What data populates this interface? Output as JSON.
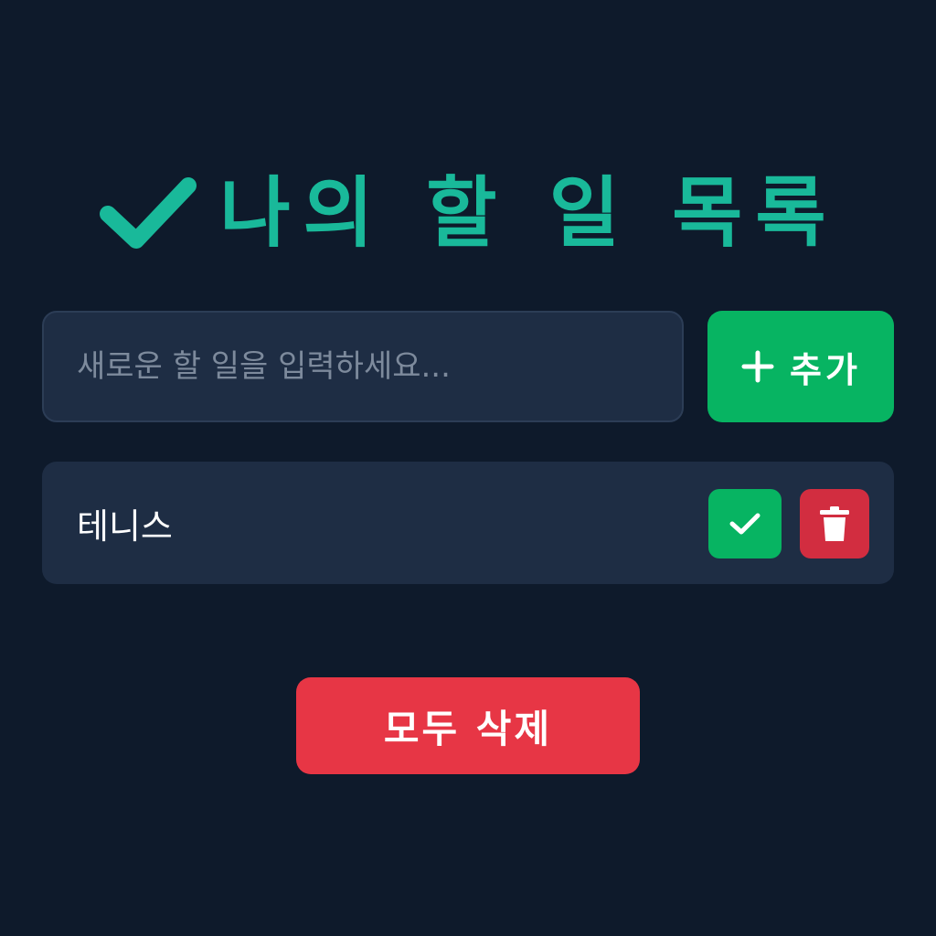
{
  "header": {
    "title": "나의 할 일 목록",
    "icon": "check-icon",
    "accent_color": "#19b99a"
  },
  "new_todo": {
    "placeholder": "새로운 할 일을 입력하세요...",
    "value": ""
  },
  "add_button": {
    "icon": "plus-icon",
    "label": "추가",
    "color": "#07b462"
  },
  "todos": [
    {
      "text": "테니스",
      "complete_icon": "check-icon",
      "delete_icon": "trash-icon"
    }
  ],
  "clear_button": {
    "label": "모두 삭제",
    "color": "#e73645"
  },
  "colors": {
    "background": "#0e1a2b",
    "panel": "#1e2d44",
    "danger": "#d22d40"
  }
}
